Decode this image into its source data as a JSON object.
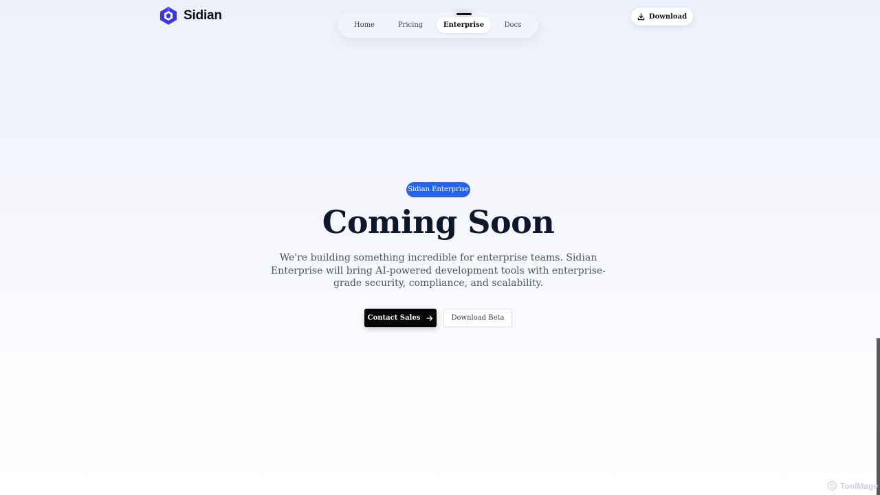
{
  "brand": {
    "name": "Sidian",
    "logo_icon": "cube-logo-icon",
    "logo_color": "#3b36e8"
  },
  "nav": {
    "items": [
      {
        "label": "Home",
        "active": false
      },
      {
        "label": "Pricing",
        "active": false
      },
      {
        "label": "Enterprise",
        "active": true
      },
      {
        "label": "Docs",
        "active": false
      }
    ]
  },
  "header": {
    "download_label": "Download",
    "download_icon": "download-icon"
  },
  "hero": {
    "badge": "Sidian Enterprise",
    "badge_color": "#2563eb",
    "title": "Coming Soon",
    "description": "We're building something incredible for enterprise teams. Sidian Enterprise will bring AI-powered development tools with enterprise-grade security, compliance, and scalability.",
    "primary_cta": "Contact Sales",
    "primary_cta_icon": "arrow-right-icon",
    "secondary_cta": "Download Beta"
  },
  "watermark": {
    "text": "ToolMage",
    "icon": "toolmage-logo-icon"
  }
}
